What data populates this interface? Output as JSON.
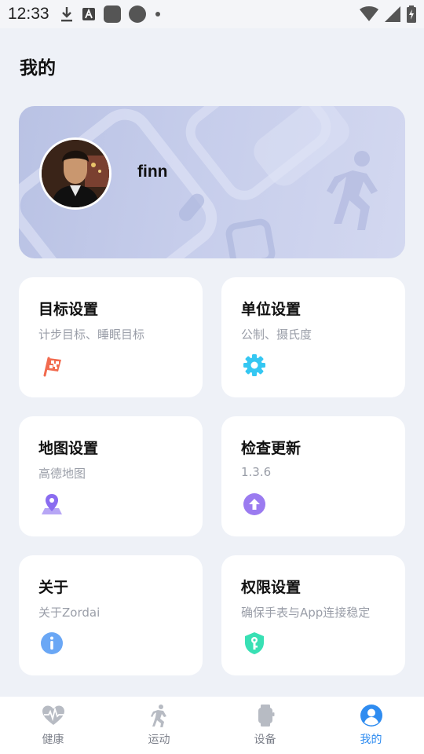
{
  "status_bar": {
    "time": "12:33"
  },
  "page": {
    "title": "我的"
  },
  "profile": {
    "username": "finn"
  },
  "tiles": [
    {
      "title": "目标设置",
      "subtitle": "计步目标、睡眠目标",
      "icon": "flag-icon",
      "color": "#f26b4f"
    },
    {
      "title": "单位设置",
      "subtitle": "公制、摄氏度",
      "icon": "gear-icon",
      "color": "#35c7f2"
    },
    {
      "title": "地图设置",
      "subtitle": "高德地图",
      "icon": "map-pin-icon",
      "color": "#9b7bf0"
    },
    {
      "title": "检查更新",
      "subtitle": "1.3.6",
      "icon": "upload-arrow-icon",
      "color": "#9b7bf0"
    },
    {
      "title": "关于",
      "subtitle": "关于Zordai",
      "icon": "info-icon",
      "color": "#6aa7f5"
    },
    {
      "title": "权限设置",
      "subtitle": "确保手表与App连接稳定",
      "icon": "shield-key-icon",
      "color": "#38e0b4"
    }
  ],
  "nav": [
    {
      "label": "健康",
      "icon": "heart-pulse-icon",
      "active": false
    },
    {
      "label": "运动",
      "icon": "runner-icon",
      "active": false
    },
    {
      "label": "设备",
      "icon": "watch-icon",
      "active": false
    },
    {
      "label": "我的",
      "icon": "user-icon",
      "active": true
    }
  ],
  "colors": {
    "accent": "#2f8cf0",
    "inactive_nav": "#b7bbc3",
    "background": "#eef1f7"
  }
}
